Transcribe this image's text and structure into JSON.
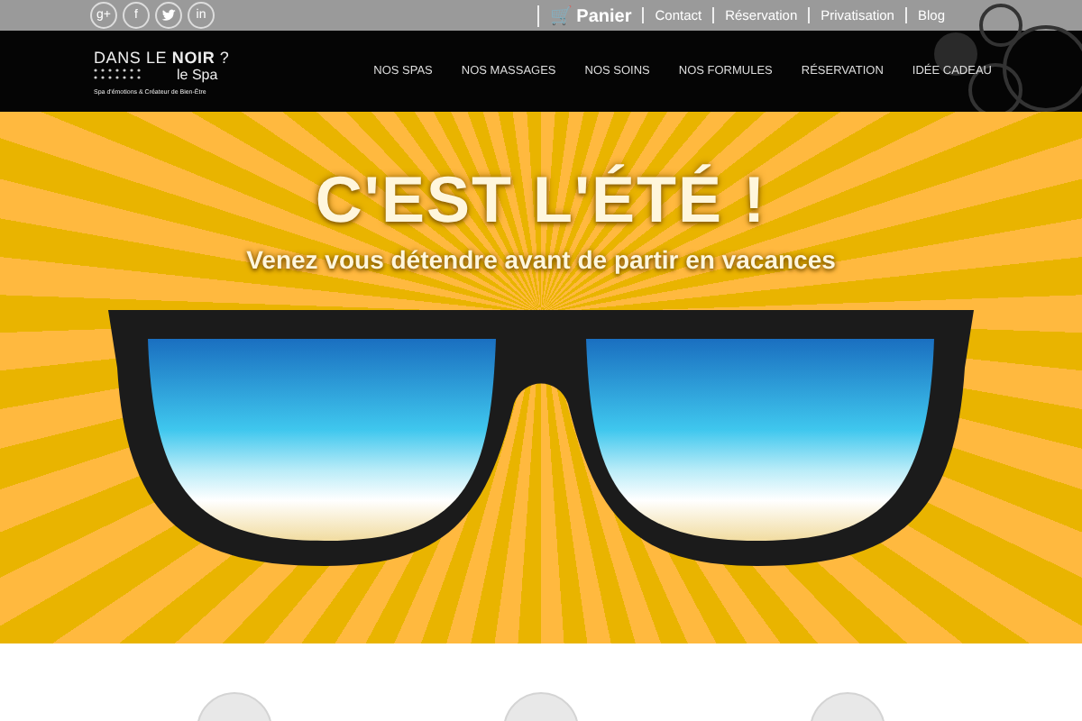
{
  "topbar": {
    "social": [
      {
        "kind": "google",
        "label": "g+"
      },
      {
        "kind": "facebook",
        "label": "f"
      },
      {
        "kind": "twitter"
      },
      {
        "kind": "linkedin",
        "label": "in"
      }
    ],
    "cart": {
      "icon": "🛒",
      "label": "Panier"
    },
    "links": [
      "Contact",
      "Réservation",
      "Privatisation",
      "Blog"
    ]
  },
  "logo": {
    "title": "DANS LE **NOIR** ?",
    "subtitle": "le Spa",
    "tagline": "Spa d'émotions & Créateur de Bien-Être"
  },
  "nav": [
    "NOS SPAS",
    "NOS MASSAGES",
    "NOS SOINS",
    "NOS FORMULES",
    "RÉSERVATION",
    "IDÉE CADEAU"
  ],
  "hero": {
    "title": "C'EST L'ÉTÉ !",
    "subtitle": "Venez vous détendre avant de partir en vacances"
  }
}
